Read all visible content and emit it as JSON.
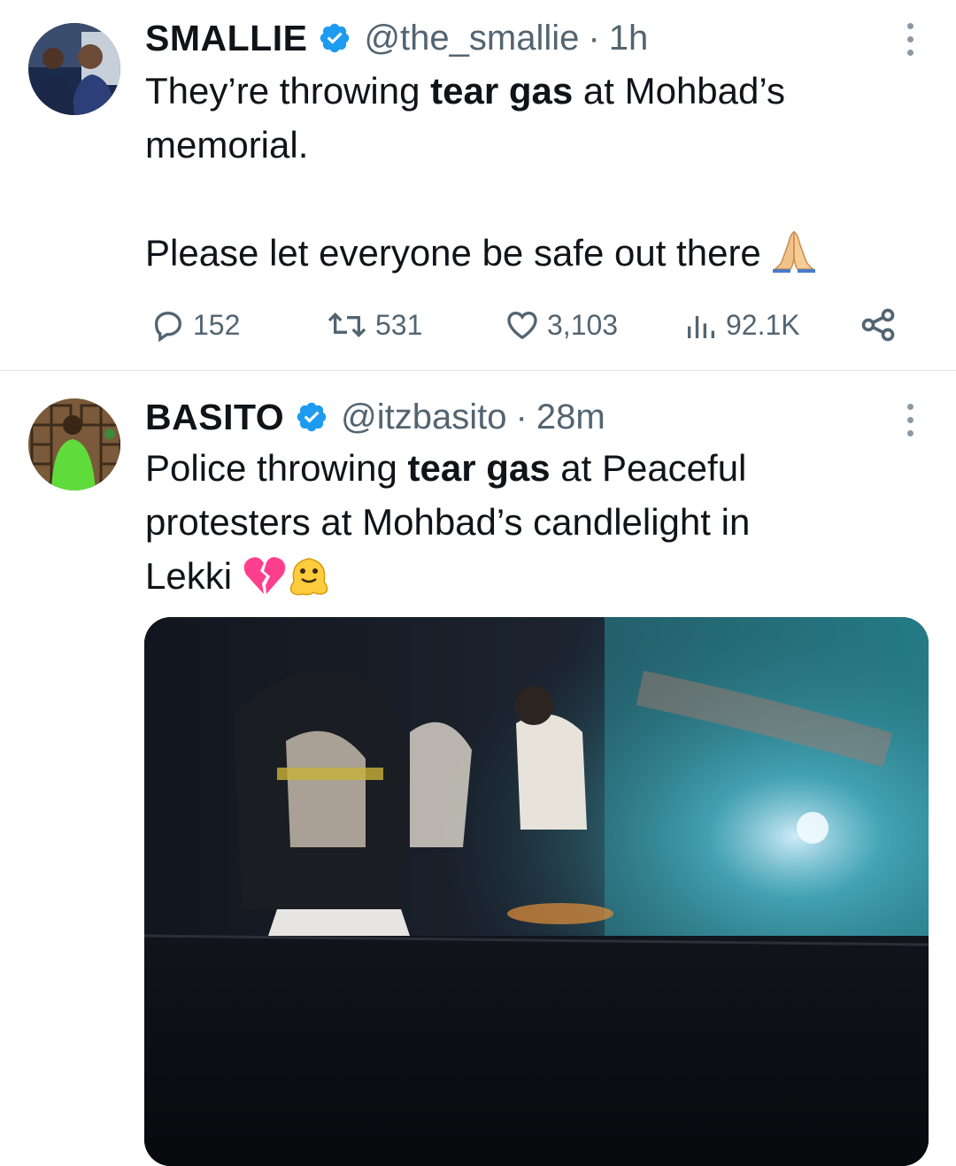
{
  "tweets": [
    {
      "display_name": "SMALLIE",
      "handle": "@the_smallie",
      "separator": "·",
      "time": "1h",
      "text_lines": [
        [
          {
            "t": "They’re throwing ",
            "b": false
          },
          {
            "t": "tear gas",
            "b": true
          },
          {
            "t": " at Mohbad’s",
            "b": false
          }
        ],
        [
          {
            "t": "memorial.",
            "b": false
          }
        ],
        [],
        [
          {
            "t": "Please let everyone be safe out there ",
            "b": false
          }
        ]
      ],
      "emoji": [
        "folded-hands"
      ],
      "replies": "152",
      "retweets": "531",
      "likes": "3,103",
      "views": "92.1K"
    },
    {
      "display_name": "BASITO",
      "handle": "@itzbasito",
      "separator": "·",
      "time": "28m",
      "text_lines": [
        [
          {
            "t": "Police throwing ",
            "b": false
          },
          {
            "t": "tear gas",
            "b": true
          },
          {
            "t": " at Peaceful",
            "b": false
          }
        ],
        [
          {
            "t": "protesters at Mohbad’s candlelight in",
            "b": false
          }
        ],
        [
          {
            "t": "Lekki ",
            "b": false
          }
        ]
      ],
      "emoji": [
        "broken-heart",
        "melting-face"
      ],
      "media": {
        "type": "video-still",
        "description_visible": false
      }
    }
  ],
  "colors": {
    "text": "#0f1419",
    "secondary": "#536471",
    "verified": "#1d9bf0",
    "divider": "#e3e6e8"
  },
  "icons": [
    "reply-icon",
    "retweet-icon",
    "like-icon",
    "views-icon",
    "share-icon",
    "more-icon",
    "verified-badge-icon"
  ]
}
